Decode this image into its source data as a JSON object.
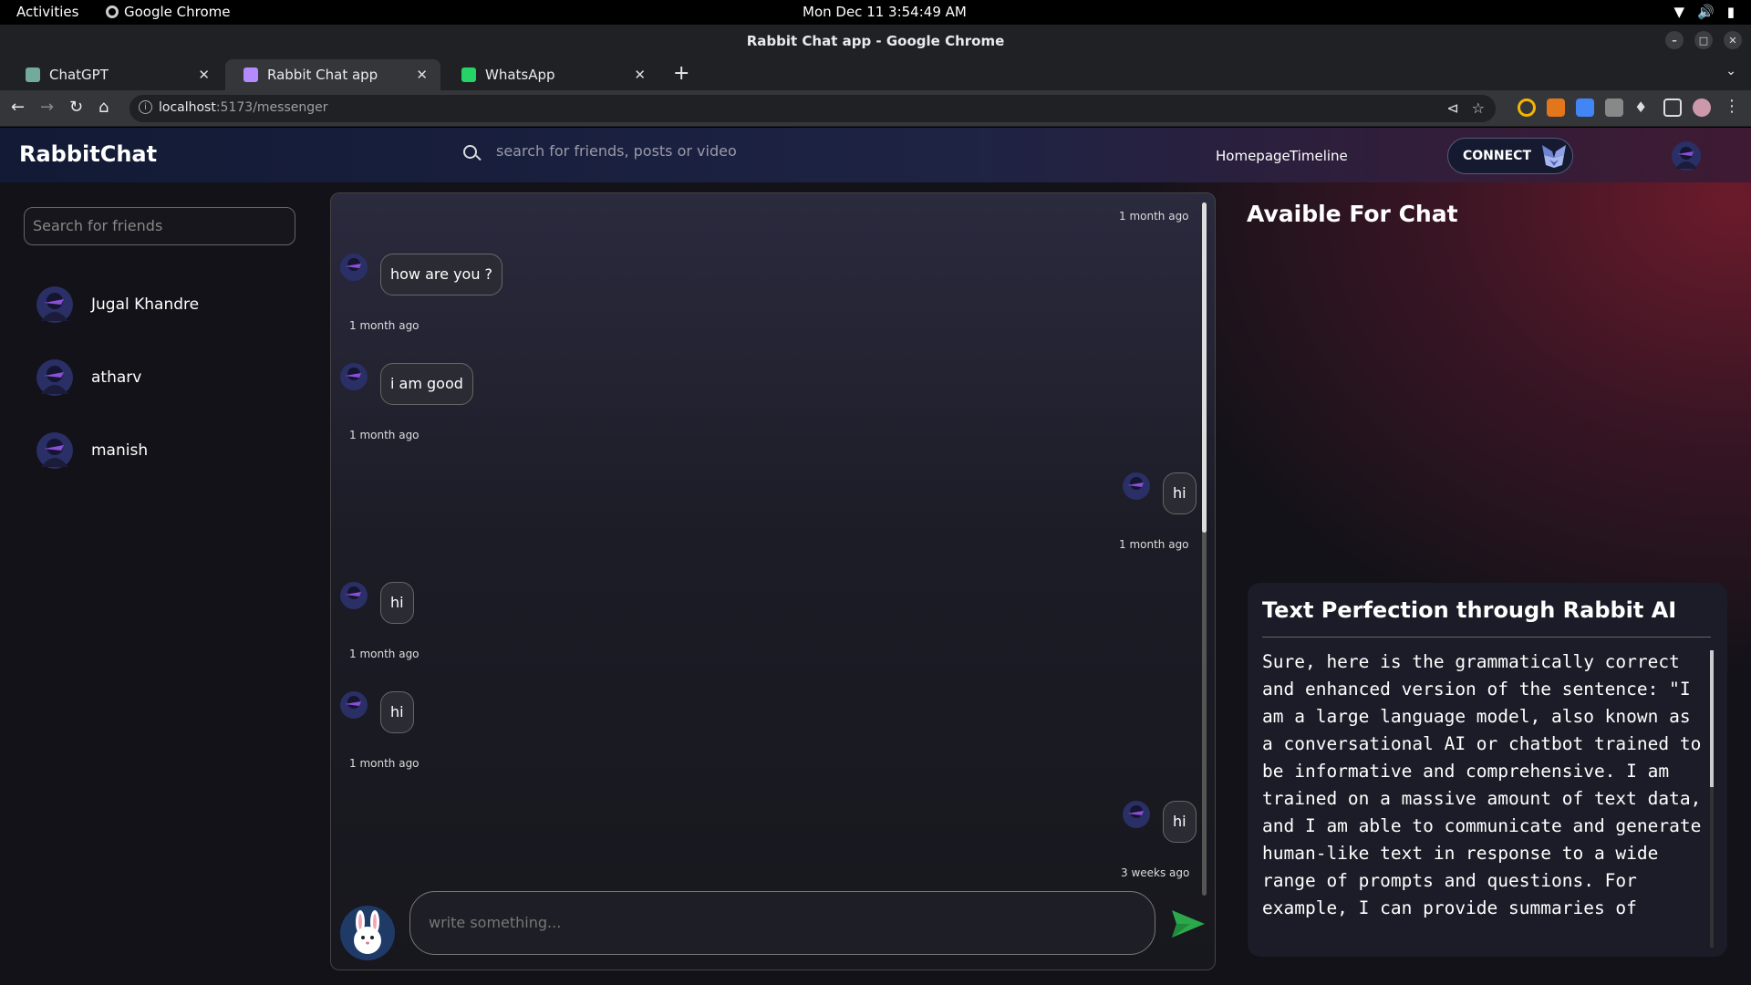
{
  "system": {
    "activities": "Activities",
    "app_name": "Google Chrome",
    "clock": "Mon Dec 11   3:54:49 AM"
  },
  "window": {
    "title": "Rabbit Chat app - Google Chrome"
  },
  "tabs": [
    {
      "label": "ChatGPT",
      "favicon_color": "#74aa9c",
      "active": false
    },
    {
      "label": "Rabbit Chat app",
      "favicon_color": "#b38bff",
      "active": true
    },
    {
      "label": "WhatsApp",
      "favicon_color": "#25d366",
      "active": false
    }
  ],
  "address": {
    "host": "localhost",
    "path": ":5173/messenger"
  },
  "app": {
    "brand": "RabbitChat",
    "search_placeholder": "search for friends, posts or video",
    "nav": {
      "homepage": "Homepage",
      "timeline": "Timeline"
    },
    "connect_label": "CONNECT"
  },
  "friends": {
    "search_placeholder": "Search for friends",
    "items": [
      {
        "name": "Jugal Khandre"
      },
      {
        "name": "atharv"
      },
      {
        "name": "manish"
      }
    ]
  },
  "messages": [
    {
      "text": "",
      "time": "1 month ago",
      "own": true
    },
    {
      "text": "how are you ?",
      "time": "1 month ago",
      "own": false
    },
    {
      "text": "i am good",
      "time": "1 month ago",
      "own": false
    },
    {
      "text": "hi",
      "time": "1 month ago",
      "own": true
    },
    {
      "text": "hi",
      "time": "1 month ago",
      "own": false
    },
    {
      "text": "hi",
      "time": "1 month ago",
      "own": false
    },
    {
      "text": "hi",
      "time": "3 weeks ago",
      "own": true
    }
  ],
  "composer": {
    "placeholder": "write something..."
  },
  "right_panel": {
    "title": "Avaible For Chat",
    "ai_card_title": "Text Perfection through Rabbit AI",
    "ai_card_text": "Sure, here is the grammatically correct and enhanced version of the sentence: \"I am a large language model, also known as a conversational AI or chatbot trained to be informative and comprehensive. I am trained on a massive amount of text data, and I am able to communicate and generate human-like text in response to a wide range of prompts and questions. For example, I can provide summaries of"
  },
  "colors": {
    "accent_send": "#2aa84a",
    "header_left": "#121a35",
    "header_right": "#3f1a33"
  }
}
